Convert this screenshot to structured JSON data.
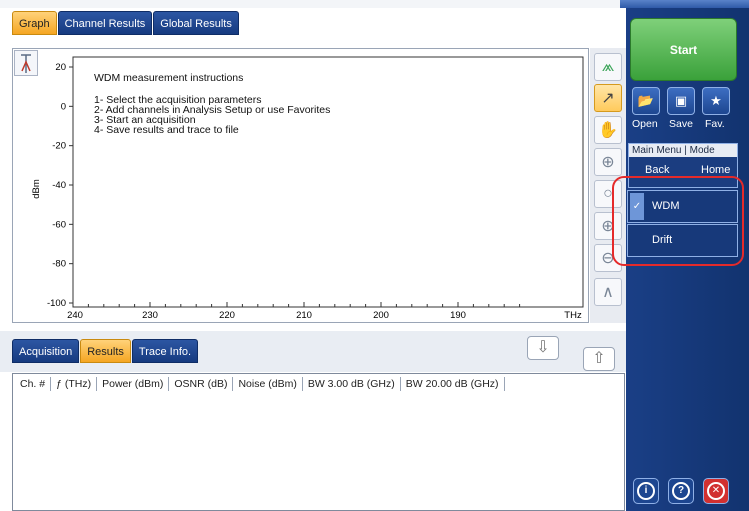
{
  "graph_tabs": [
    "Graph",
    "Channel Results",
    "Global Results"
  ],
  "graph_tab_active": "Graph",
  "instructions": {
    "title": "WDM measurement instructions",
    "steps": [
      "1- Select the acquisition parameters",
      "2- Add channels in Analysis Setup or use Favorites",
      "3- Start an acquisition",
      "4- Save results and trace to file"
    ]
  },
  "plot": {
    "y_label": "dBm",
    "x_unit": "THz",
    "y_ticks": [
      "20",
      "0",
      "-20",
      "-40",
      "-60",
      "-80",
      "-100"
    ],
    "x_ticks": [
      "240",
      "230",
      "220",
      "210",
      "200",
      "190"
    ]
  },
  "toolbar_icons": [
    "auto-scale-icon",
    "pointer-icon",
    "pan-hand-icon",
    "zoom-area-icon",
    "zoom-reset-icon",
    "zoom-in-icon",
    "zoom-out-icon",
    "peak-icon"
  ],
  "bottom_tabs": [
    "Acquisition",
    "Results",
    "Trace Info."
  ],
  "bottom_tab_active": "Results",
  "results_table": {
    "columns": [
      "Ch. #",
      "ƒ (THz)",
      "Power (dBm)",
      "OSNR (dB)",
      "Noise (dBm)",
      "BW 3.00 dB (GHz)",
      "BW 20.00 dB (GHz)"
    ],
    "rows": []
  },
  "right_panel": {
    "start_label": "Start",
    "quick_buttons": [
      {
        "label": "Open",
        "icon": "folder-open-icon"
      },
      {
        "label": "Save",
        "icon": "save-disk-icon"
      },
      {
        "label": "Fav.",
        "icon": "star-icon"
      }
    ],
    "menu_header": "Main Menu | Mode",
    "menu_back": "Back",
    "menu_home": "Home",
    "modes": [
      {
        "label": "WDM",
        "checked": true
      },
      {
        "label": "Drift",
        "checked": false
      }
    ],
    "bottom_icons": [
      "info-icon",
      "help-icon",
      "close-icon"
    ]
  },
  "colors": {
    "active_tab": "#f5a623",
    "tab": "#1f4a95",
    "panel": "#17397a",
    "start": "#3aa13a",
    "highlight": "#e52a2a"
  }
}
